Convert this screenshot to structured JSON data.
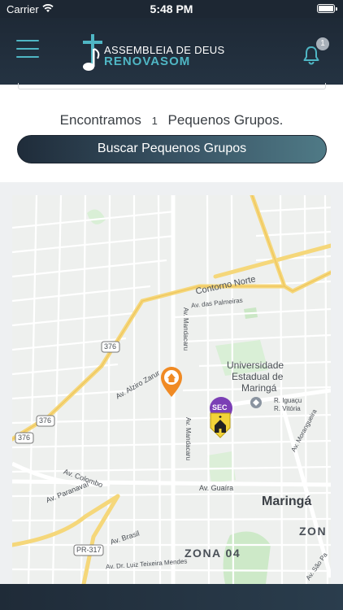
{
  "status_bar": {
    "carrier": "Carrier",
    "time": "5:48 PM",
    "battery_level": 1.0
  },
  "header": {
    "logo_line1": "ASSEMBLEIA DE DEUS",
    "logo_line2": "RENOVASOM",
    "notification_count": "1",
    "accent_color": "#4fb6c4"
  },
  "results": {
    "prefix": "Encontramos",
    "count": "1",
    "suffix": "Pequenos Grupos."
  },
  "search_button": {
    "label": "Buscar Pequenos Grupos"
  },
  "map": {
    "labels": {
      "contorno_norte": "Contorno Norte",
      "av_palmeiras": "Av. das Palmeiras",
      "route_376_a": "376",
      "route_376_b": "376",
      "route_376_c": "376",
      "av_alziro_zarur": "Av. Alziro Zarur",
      "av_mandacaru_1": "Av. Mandacaru",
      "av_mandacaru_2": "Av. Mandacaru",
      "uem_1": "Universidade",
      "uem_2": "Estadual de",
      "uem_3": "Maringá",
      "r_iguacu": "R. Iguaçu",
      "r_vitoria": "R. Vitória",
      "av_morangueira": "Av. Morangueira",
      "av_colombo": "Av. Colombo",
      "av_paranavai": "Av. Paranavaí",
      "av_guaira": "Av. Guaíra",
      "maringa": "Maringá",
      "pr317": "PR-317",
      "av_brasil": "Av. Brasil",
      "zona04": "ZONA 04",
      "zona_partial": "ZON",
      "av_dr_luiz": "Av. Dr. Luiz Teixeira Mendes",
      "av_sao_paulo": "Av. São Pa",
      "sec_marker": "SEC"
    }
  }
}
